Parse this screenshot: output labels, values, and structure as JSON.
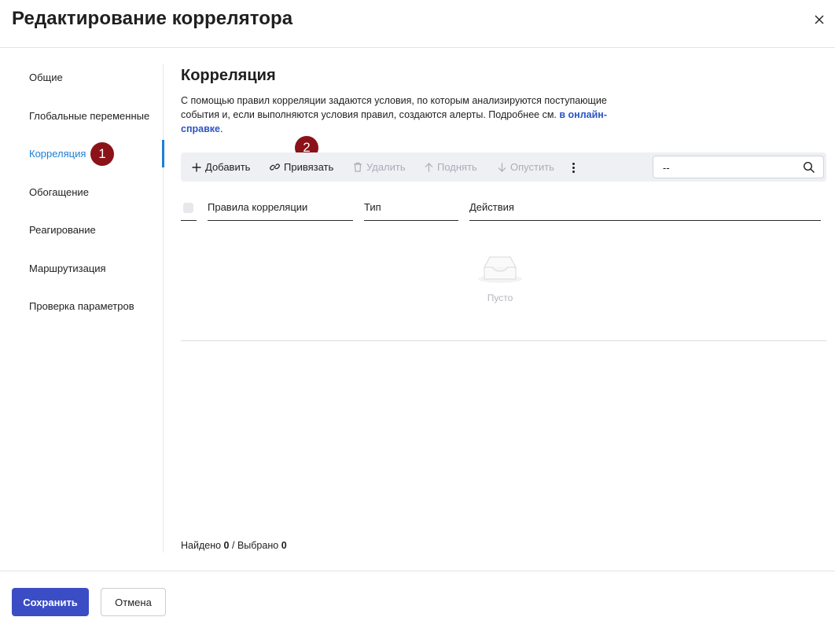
{
  "dialog": {
    "title": "Редактирование коррелятора",
    "close_icon": "close-icon"
  },
  "sidebar": {
    "items": [
      {
        "label": "Общие"
      },
      {
        "label": "Глобальные переменные"
      },
      {
        "label": "Корреляция",
        "active": true
      },
      {
        "label": "Обогащение"
      },
      {
        "label": "Реагирование"
      },
      {
        "label": "Маршрутизация"
      },
      {
        "label": "Проверка параметров"
      }
    ],
    "accent_color": "#1c7fd6"
  },
  "badges": {
    "first": "1",
    "second": "2",
    "color": "#8b1218"
  },
  "section": {
    "title": "Корреляция",
    "description": "С помощью правил корреляции задаются условия, по которым анализируются поступающие события и, если выполняются условия правил, создаются алерты. Подробнее см.",
    "link_text": "в онлайн-справке",
    "description_end": "."
  },
  "toolbar": {
    "add_label": "Добавить",
    "link_label": "Привязать",
    "delete_label": "Удалить",
    "up_label": "Поднять",
    "down_label": "Опустить",
    "search_value": "--"
  },
  "table": {
    "columns": [
      "Правила корреляции",
      "Тип",
      "Действия"
    ],
    "rows": [],
    "empty_text": "Пусто"
  },
  "status": {
    "found_label": "Найдено",
    "found_count": "0",
    "separator": "/",
    "selected_label": "Выбрано",
    "selected_count": "0"
  },
  "footer": {
    "save_label": "Сохранить",
    "cancel_label": "Отмена",
    "primary_color": "#3a4dc4"
  }
}
